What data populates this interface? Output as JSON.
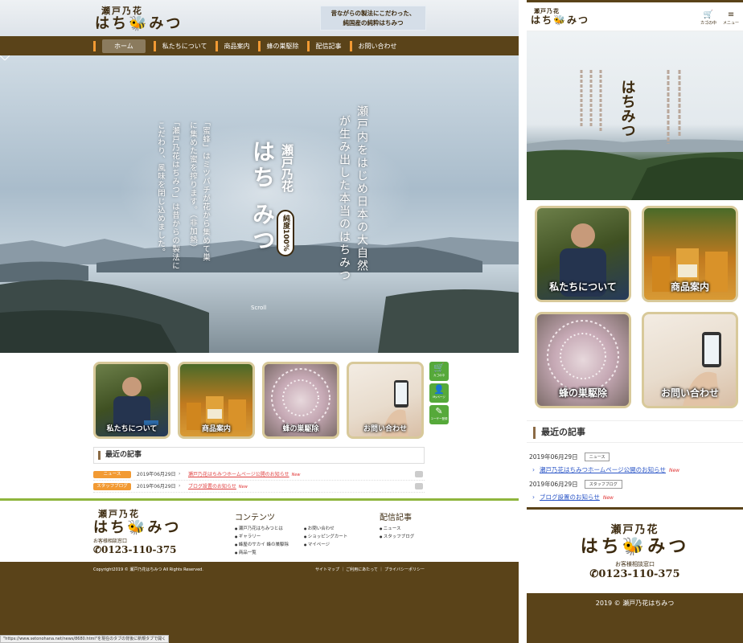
{
  "desktop": {
    "logo": {
      "line1": "瀬戸乃花",
      "line2": "はち🐝みつ"
    },
    "tagline": {
      "line1": "昔ながらの製法にこだわった、",
      "line2": "純国産の純粋はちみつ"
    },
    "nav": [
      "ホーム",
      "私たちについて",
      "商品案内",
      "蜂の巣駆除",
      "配信記事",
      "お問い合わせ"
    ],
    "hero": {
      "col1": "瀬戸内をはじめ日本の大自然",
      "col2": "が生み出した本当のはちみつ",
      "brand_small": "瀬戸乃花",
      "brand_big": "はち みつ",
      "badge": "純度100%",
      "desc1": "「瀬戸乃花はちみつ」は昔からの製法に",
      "desc2": "に集めた蜜を搾ります。（非加熱）",
      "desc3": "「蜜蜂」はミツバチが花から集めて巣",
      "desc4": "こだわり、風味を閉じ込めました。",
      "scroll": "Scroll"
    },
    "tiles": [
      "私たちについて",
      "商品案内",
      "蜂の巣駆除",
      "お問い合わせ"
    ],
    "side_buttons": [
      {
        "icon": "🛒",
        "label": "カゴの中"
      },
      {
        "icon": "👤",
        "label": "Myページ"
      },
      {
        "icon": "✎",
        "label": "ユーザー登録"
      }
    ],
    "recent": {
      "title": "最近の記事",
      "items": [
        {
          "tag": "ニュース",
          "date": "2019年06月29日",
          "title": "瀬戸乃花はちみつホームページ公開のお知らせ",
          "new": "New"
        },
        {
          "tag": "スタッフブログ",
          "date": "2019年06月29日",
          "title": "ブログ設置のお知らせ",
          "new": "New"
        }
      ]
    },
    "footer": {
      "logo1": "瀬戸乃花",
      "logo2": "はち🐝みつ",
      "contact_label": "お客様相談窓口",
      "phone": "✆0123-110-375",
      "contents_heading": "コンテンツ",
      "contents_col1": [
        "瀬戸乃花はちみつとは",
        "ギャラリー",
        "蜂屋のサカイ 蜂の巣駆除",
        "商品一覧"
      ],
      "contents_col2": [
        "お問い合わせ",
        "ショッピングカート",
        "マイページ"
      ],
      "feeds_heading": "配信記事",
      "feeds": [
        "ニュース",
        "スタッフブログ"
      ],
      "copyright": "Copyright2019 © 瀬戸乃花はちみつ All Rights Reserved.",
      "links": "サイトマップ ｜ ご利用にあたって ｜ プライバシーポリシー"
    },
    "status_url": "\"https://www.setonohana.net/news/8680.html\"を現在のタブの背後に新規タブで開く"
  },
  "mobile": {
    "logo": {
      "line1": "瀬戸乃花",
      "line2": "はち🐝みつ"
    },
    "cart": {
      "icon": "🛒",
      "label": "カゴの中"
    },
    "menu": {
      "icon": "≡",
      "label": "メニュー"
    },
    "tiles": [
      "私たちについて",
      "商品案内",
      "蜂の巣駆除",
      "お問い合わせ"
    ],
    "recent_title": "最近の記事",
    "news": [
      {
        "date": "2019年06月29日",
        "tag": "ニュース",
        "title": "瀬戸乃花はちみつホームページ公開のお知らせ",
        "new": "New"
      },
      {
        "date": "2019年06月29日",
        "tag": "スタッフブログ",
        "title": "ブログ設置のお知らせ",
        "new": "New"
      }
    ],
    "footer": {
      "logo1": "瀬戸乃花",
      "logo2": "はち🐝みつ",
      "contact_label": "お客様相談窓口",
      "phone": "✆0123-110-375"
    },
    "copyright": "2019 © 瀬戸乃花はちみつ"
  },
  "colors": {
    "brown": "#5a4319",
    "orange": "#f29a33",
    "green": "#56a93a",
    "gold": "#d8c99a",
    "link_blue": "#2a55c7",
    "new_red": "#e03030"
  }
}
